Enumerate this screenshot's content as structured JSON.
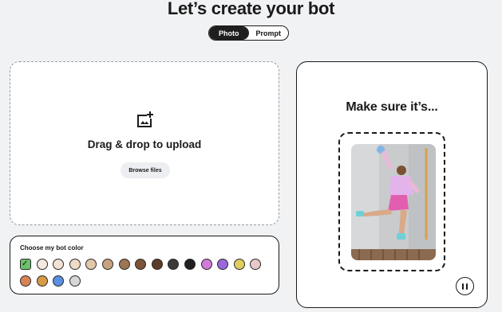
{
  "header": {
    "title": "Let’s create your bot"
  },
  "mode_toggle": {
    "options": [
      "Photo",
      "Prompt"
    ],
    "selected": "Photo"
  },
  "upload": {
    "icon": "add-photo-icon",
    "drop_text": "Drag & drop to upload",
    "browse_label": "Browse files"
  },
  "color_picker": {
    "label": "Choose my bot color",
    "selected_index": 0,
    "swatches": [
      "#6cc06a",
      "#f5e9e0",
      "#f3e2d4",
      "#efdcc6",
      "#e3c7aa",
      "#c7a27e",
      "#9a7652",
      "#7d5437",
      "#5b3a2a",
      "#3a3a3a",
      "#1f1f1f",
      "#d27ad8",
      "#9a68dc",
      "#e0cd5f",
      "#e8c8c8",
      "#d98355",
      "#d99a45",
      "#5b8fe0",
      "#d7d7d7"
    ]
  },
  "guide": {
    "heading": "Make sure it’s...",
    "pause_icon": "pause-icon"
  }
}
